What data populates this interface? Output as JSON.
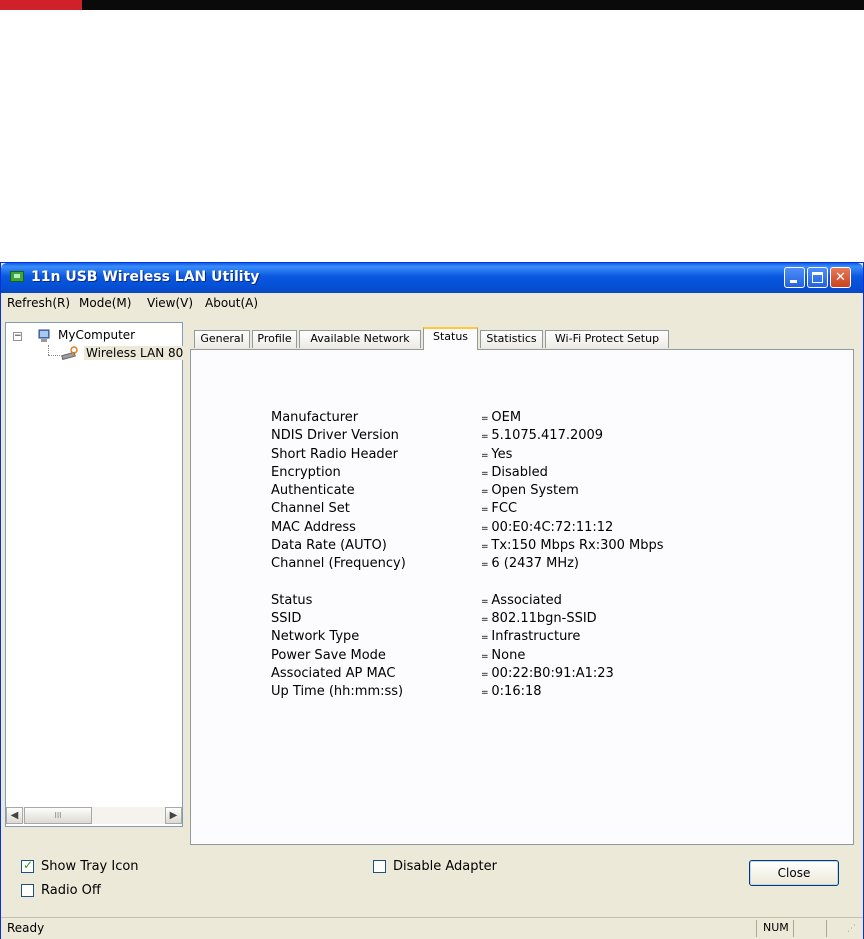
{
  "window": {
    "title": "11n USB Wireless LAN Utility"
  },
  "menu": [
    "Refresh(R)",
    "Mode(M)",
    "View(V)",
    "About(A)"
  ],
  "tree": {
    "root": "MyComputer",
    "child": "Wireless LAN 80",
    "expander": "−"
  },
  "tabs": [
    "General",
    "Profile",
    "Available Network",
    "Status",
    "Statistics",
    "Wi-Fi Protect Setup"
  ],
  "active_tab": "Status",
  "status_group1": [
    {
      "label": "Manufacturer",
      "value": "OEM"
    },
    {
      "label": "NDIS Driver Version",
      "value": "5.1075.417.2009"
    },
    {
      "label": "Short Radio Header",
      "value": "Yes"
    },
    {
      "label": "Encryption",
      "value": "Disabled"
    },
    {
      "label": "Authenticate",
      "value": "Open System"
    },
    {
      "label": "Channel Set",
      "value": "FCC"
    },
    {
      "label": "MAC Address",
      "value": "00:E0:4C:72:11:12"
    },
    {
      "label": "Data Rate (AUTO)",
      "value": "Tx:150 Mbps Rx:300 Mbps"
    },
    {
      "label": "Channel (Frequency)",
      "value": "6 (2437 MHz)"
    }
  ],
  "status_group2": [
    {
      "label": "Status",
      "value": "Associated"
    },
    {
      "label": "SSID",
      "value": "802.11bgn-SSID"
    },
    {
      "label": "Network Type",
      "value": "Infrastructure"
    },
    {
      "label": "Power Save Mode",
      "value": "None"
    },
    {
      "label": "Associated AP MAC",
      "value": "00:22:B0:91:A1:23"
    },
    {
      "label": "Up Time (hh:mm:ss)",
      "value": "0:16:18"
    }
  ],
  "bottom": {
    "show_tray_icon": {
      "label": "Show Tray Icon",
      "checked": true
    },
    "radio_off": {
      "label": "Radio Off",
      "checked": false
    },
    "disable_adapter": {
      "label": "Disable Adapter",
      "checked": false
    },
    "close_label": "Close"
  },
  "statusbar": {
    "text": "Ready",
    "num": "NUM"
  },
  "colors": {
    "title_bar": "#0a58e0",
    "face": "#ece9d8",
    "active_tab_accent": "#ffc83c"
  }
}
